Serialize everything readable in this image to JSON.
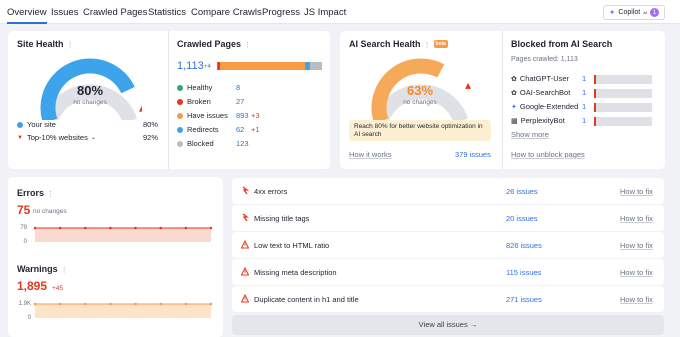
{
  "tabs": [
    "Overview",
    "Issues",
    "Crawled Pages",
    "Statistics",
    "Compare Crawls",
    "Progress",
    "JS Impact"
  ],
  "copilot": {
    "label": "Copilot",
    "sup": "AI",
    "badge": "1"
  },
  "site_health": {
    "title": "Site Health",
    "value": "80%",
    "caption": "no changes",
    "your_site_label": "Your site",
    "your_site_value": "80%",
    "top_label": "Top-10% websites",
    "top_value": "92%",
    "score": 0.8,
    "top": 0.92
  },
  "crawled": {
    "title": "Crawled Pages",
    "total": "1,113",
    "delta": "+4",
    "rows": [
      {
        "label": "Healthy",
        "value": "8",
        "delta": "",
        "color": "#3aa36f"
      },
      {
        "label": "Broken",
        "value": "27",
        "delta": "",
        "color": "#e5371d"
      },
      {
        "label": "Have issues",
        "value": "893",
        "delta": "+3",
        "color": "#f79b45"
      },
      {
        "label": "Redirects",
        "value": "62",
        "delta": "+1",
        "color": "#3da4ec"
      },
      {
        "label": "Blocked",
        "value": "123",
        "delta": "",
        "color": "#b8bcc6"
      }
    ]
  },
  "ai_health": {
    "title": "AI Search Health",
    "beta": "beta",
    "value": "63%",
    "caption": "no changes",
    "note": "Reach 80% for better website optimization in AI search",
    "how": "How it works",
    "issues": "379 issues",
    "score": 0.63
  },
  "blocked_ai": {
    "title": "Blocked from AI Search",
    "subtitle": "Pages crawled: 1,113",
    "bots": [
      {
        "name": "ChatGPT-User",
        "value": "1",
        "icon": "openai-icon"
      },
      {
        "name": "OAI-SearchBot",
        "value": "1",
        "icon": "openai-icon"
      },
      {
        "name": "Google-Extended",
        "value": "1",
        "icon": "gemini-icon"
      },
      {
        "name": "PerplexityBot",
        "value": "1",
        "icon": "perplexity-icon"
      }
    ],
    "more": "Show more",
    "unblock": "How to unblock pages"
  },
  "errors": {
    "title": "Errors",
    "value": "75",
    "caption": "no changes",
    "ymax": "79",
    "ymin": "0",
    "points": [
      79,
      79,
      79,
      79,
      79,
      79,
      79,
      79
    ]
  },
  "warnings": {
    "title": "Warnings",
    "value": "1,895",
    "delta": "+45",
    "ymax": "1.9K",
    "ymin": "0",
    "points": [
      1895,
      1895,
      1895,
      1895,
      1895,
      1895,
      1895,
      1895
    ]
  },
  "issues": [
    {
      "label": "4xx errors",
      "count": "26 issues",
      "fix": "How to fix",
      "type": "error"
    },
    {
      "label": "Missing title tags",
      "count": "20 issues",
      "fix": "How to fix",
      "type": "error"
    },
    {
      "label": "Low text to HTML ratio",
      "count": "826 issues",
      "fix": "How to fix",
      "type": "warning"
    },
    {
      "label": "Missing meta description",
      "count": "115 issues",
      "fix": "How to fix",
      "type": "warning"
    },
    {
      "label": "Duplicate content in h1 and title",
      "count": "271 issues",
      "fix": "How to fix",
      "type": "warning"
    }
  ],
  "view_all": "View all issues",
  "colors": {
    "accent": "#2f6fe0",
    "error": "#e5371d",
    "warning": "#f79b45",
    "gauge_blue": "#3da4ec",
    "gauge_orange": "#f7a95a"
  }
}
